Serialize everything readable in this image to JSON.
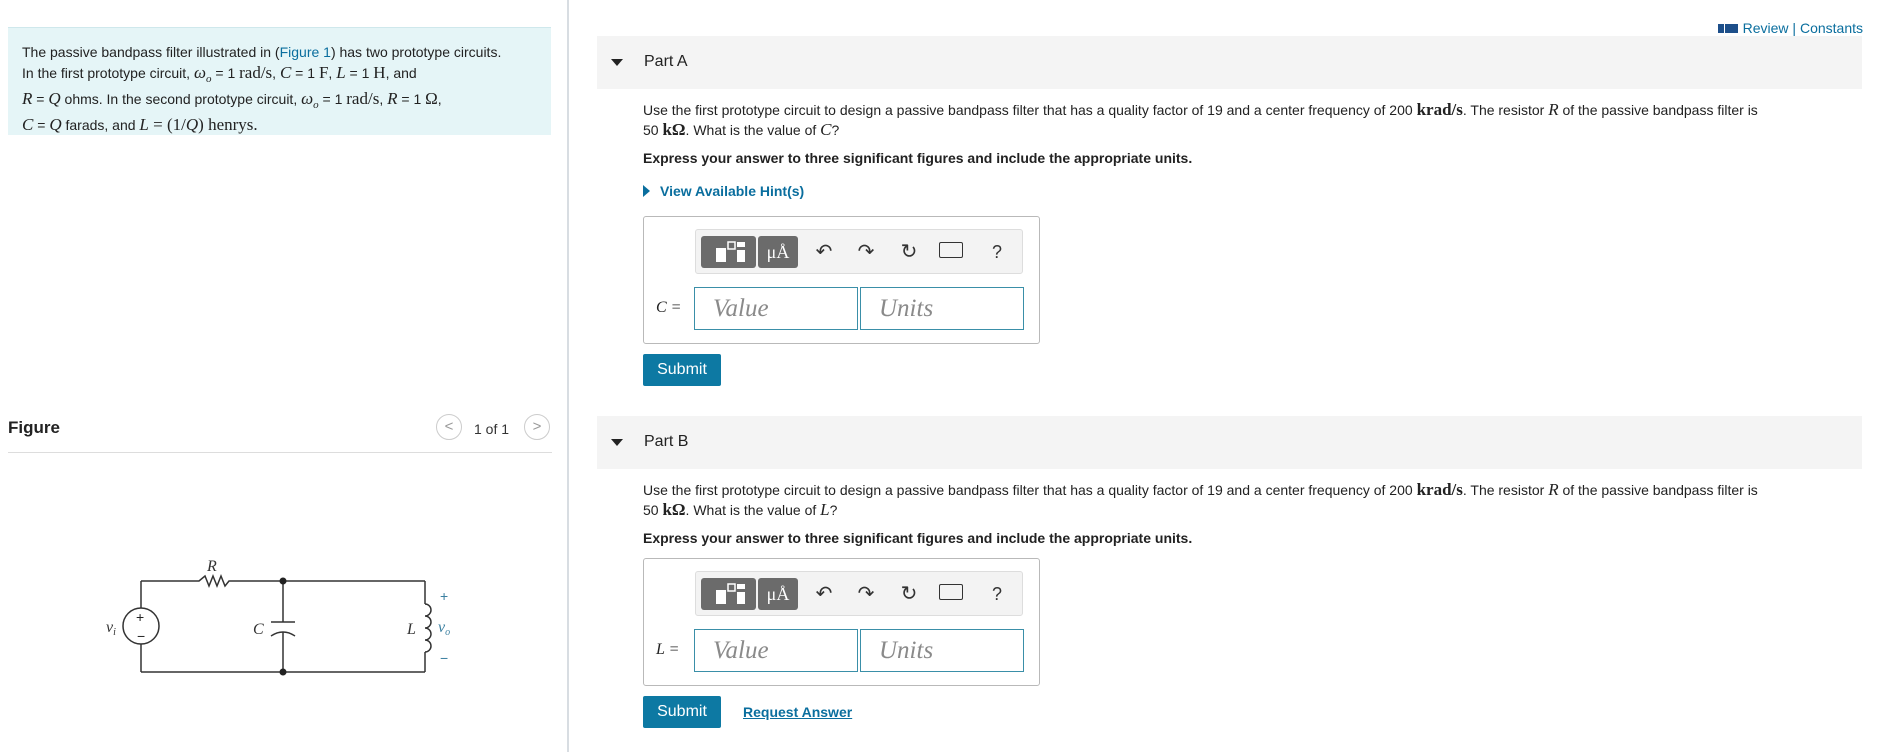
{
  "intro": {
    "l1_text": "The passive bandpass filter illustrated in (",
    "l1_link": "Figure 1",
    "l1_end": ") has two prototype circuits.",
    "l2_a": "In the first prototype circuit, ",
    "l2_omega": "ω",
    "l2_sub": "o",
    "l2_b": " = 1 ",
    "l2_unit1": "rad/s",
    "l2_c": ", ",
    "l2_C": "C",
    "l2_d": " = 1 ",
    "l2_F": "F",
    "l2_e": ", ",
    "l2_L": "L",
    "l2_f": " = 1 ",
    "l2_H": "H",
    "l2_g": ", and",
    "l3_R": "R",
    "l3_a": " = ",
    "l3_Q": "Q",
    "l3_b": " ohms. In the second prototype circuit, ",
    "l3_omega": "ω",
    "l3_sub": "o",
    "l3_c": " = 1 ",
    "l3_unit": "rad/s",
    "l3_d": ", ",
    "l3_R2": "R",
    "l3_e": " = 1 ",
    "l3_ohm": "Ω",
    "l3_f": ",",
    "l4_C": "C",
    "l4_a": " = ",
    "l4_Q": "Q",
    "l4_b": " farads, and ",
    "l4_L": "L",
    "l4_c": " = (1/",
    "l4_Q2": "Q",
    "l4_d": ") henrys."
  },
  "figure": {
    "title": "Figure",
    "pager": "1 of 1",
    "prev": "<",
    "next": ">",
    "labels": {
      "R": "R",
      "C": "C",
      "L": "L",
      "vi": "v",
      "vi_sub": "i",
      "vo": "v",
      "vo_sub": "o",
      "plus": "+",
      "minus": "−",
      "src_plus": "+",
      "src_minus": "−"
    }
  },
  "review": {
    "text": "Review | Constants"
  },
  "partA": {
    "title": "Part A",
    "q1": "Use the first prototype circuit to design a passive bandpass filter that has a quality factor of 19 and a center frequency of 200 ",
    "q_unit": "krad/s",
    "q2": ". The resistor ",
    "q_R": "R",
    "q3": " of the passive bandpass filter is",
    "q4": "50 ",
    "q_kohm": "kΩ",
    "q5": ". What is the value of ",
    "q_var": "C",
    "q6": "?",
    "instruction": "Express your answer to three significant figures and include the appropriate units.",
    "hints": "View Available Hint(s)",
    "var_label": "C =",
    "value_placeholder": "Value",
    "units_placeholder": "Units",
    "submit": "Submit"
  },
  "partB": {
    "title": "Part B",
    "q1": "Use the first prototype circuit to design a passive bandpass filter that has a quality factor of 19 and a center frequency of 200 ",
    "q_unit": "krad/s",
    "q2": ". The resistor ",
    "q_R": "R",
    "q3": " of the passive bandpass filter is",
    "q4": "50 ",
    "q_kohm": "kΩ",
    "q5": ". What is the value of ",
    "q_var": "L",
    "q6": "?",
    "instruction": "Express your answer to three significant figures and include the appropriate units.",
    "var_label": "L =",
    "value_placeholder": "Value",
    "units_placeholder": "Units",
    "submit": "Submit",
    "request": "Request Answer"
  },
  "toolbar": {
    "mu": "μÅ",
    "undo": "↶",
    "redo": "↷",
    "reset": "↻",
    "help": "?"
  },
  "colors": {
    "accent": "#0d79a3",
    "intro_bg": "#e5f5f7",
    "link": "#0a6e9e"
  }
}
